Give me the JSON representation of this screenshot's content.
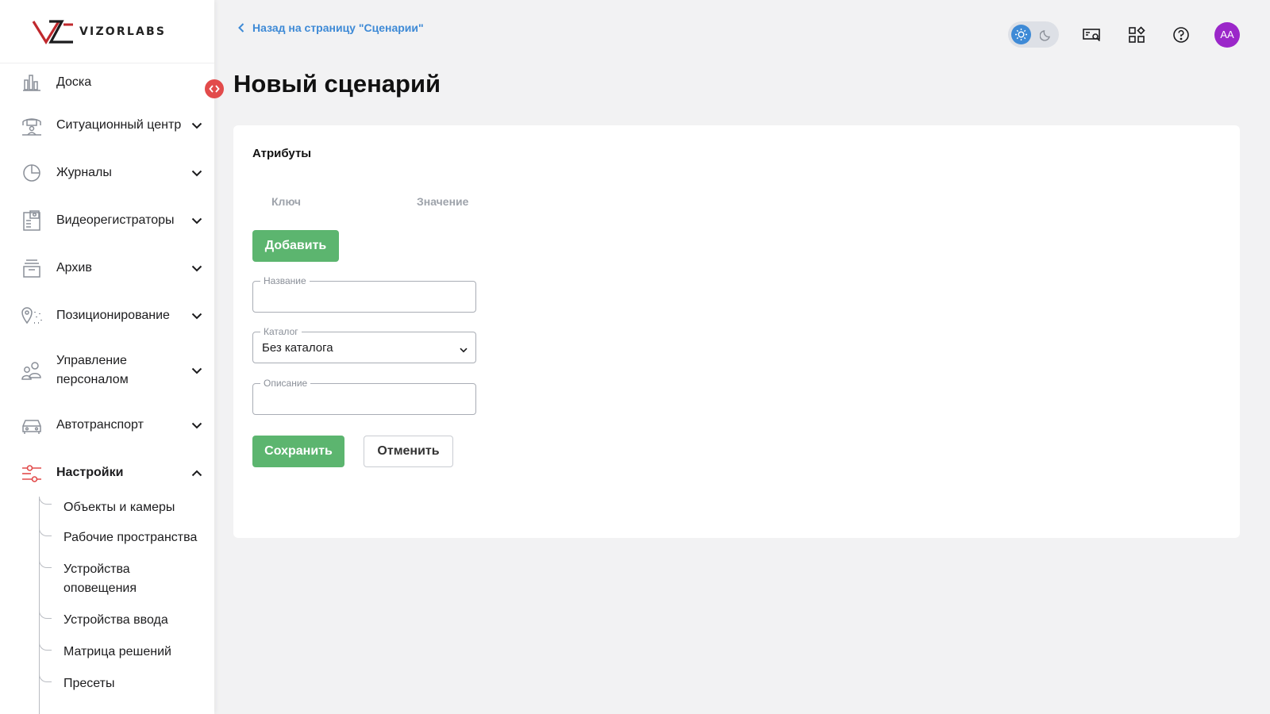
{
  "brand": {
    "name": "VIZORLABS"
  },
  "sidebar": {
    "items": [
      {
        "label": "Доска",
        "icon": "dashboard-chart-icon",
        "has_chevron": false
      },
      {
        "label": "Ситуационный центр",
        "icon": "situation-center-icon",
        "has_chevron": true
      },
      {
        "label": "Журналы",
        "icon": "journals-pie-icon",
        "has_chevron": true
      },
      {
        "label": "Видеорегистраторы",
        "icon": "video-recorder-icon",
        "has_chevron": true
      },
      {
        "label": "Архив",
        "icon": "archive-box-icon",
        "has_chevron": true
      },
      {
        "label": "Позиционирование",
        "icon": "location-pin-icon",
        "has_chevron": true
      },
      {
        "label": "Управление персоналом",
        "icon": "people-icon",
        "has_chevron": true
      },
      {
        "label": "Автотранспорт",
        "icon": "car-icon",
        "has_chevron": true
      },
      {
        "label": "Настройки",
        "icon": "settings-sliders-icon",
        "has_chevron": true,
        "active": true
      }
    ],
    "settings_subitems": [
      "Объекты и камеры",
      "Рабочие пространства",
      "Устройства оповещения",
      "Устройства ввода",
      "Матрица решений",
      "Пресеты"
    ]
  },
  "header": {
    "back_link": "Назад на страницу \"Сценарии\"",
    "title": "Новый сценарий",
    "avatar_initials": "AA",
    "theme": "light"
  },
  "form": {
    "attributes_title": "Атрибуты",
    "attr_key_header": "Ключ",
    "attr_value_header": "Значение",
    "add_button": "Добавить",
    "name_label": "Название",
    "name_value": "",
    "catalog_label": "Каталог",
    "catalog_value": "Без каталога",
    "description_label": "Описание",
    "description_value": "",
    "save_button": "Сохранить",
    "cancel_button": "Отменить"
  },
  "colors": {
    "accent_blue": "#3e8ad6",
    "accent_green": "#5cb56f",
    "active_red": "#e24b4b",
    "avatar_purple": "#9b27c9"
  }
}
